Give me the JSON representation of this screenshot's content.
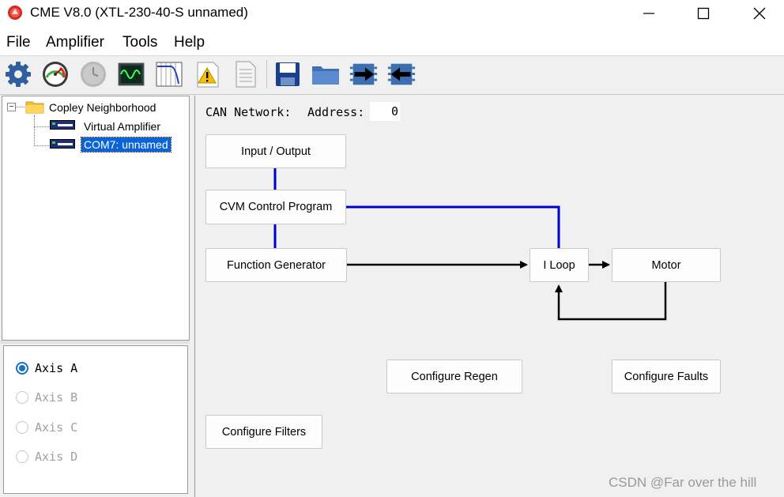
{
  "window": {
    "title": "CME V8.0 (XTL-230-40-S unnamed)",
    "controls": [
      "minimize",
      "maximize",
      "close"
    ]
  },
  "menubar": {
    "items": [
      "File",
      "Amplifier",
      "Tools",
      "Help"
    ]
  },
  "toolbar": {
    "buttons": [
      {
        "icon": "gear-icon",
        "enabled": true
      },
      {
        "icon": "gauge-icon",
        "enabled": true
      },
      {
        "icon": "clock-icon",
        "enabled": false
      },
      {
        "icon": "oscilloscope-icon",
        "enabled": true
      },
      {
        "icon": "filter-chart-icon",
        "enabled": true
      },
      {
        "icon": "warning-icon",
        "enabled": true
      },
      {
        "icon": "document-icon",
        "enabled": true
      },
      {
        "icon": "save-icon",
        "enabled": true
      },
      {
        "icon": "folder-icon",
        "enabled": true
      },
      {
        "icon": "download-to-amp-icon",
        "enabled": true
      },
      {
        "icon": "upload-from-amp-icon",
        "enabled": true
      }
    ]
  },
  "tree": {
    "root": "Copley Neighborhood",
    "children": [
      "Virtual Amplifier",
      "COM7: unnamed"
    ],
    "selected": "COM7: unnamed",
    "collapse_glyph": "−"
  },
  "axes": {
    "items": [
      {
        "label": "Axis A",
        "checked": true,
        "enabled": true
      },
      {
        "label": "Axis B",
        "checked": false,
        "enabled": false
      },
      {
        "label": "Axis C",
        "checked": false,
        "enabled": false
      },
      {
        "label": "Axis D",
        "checked": false,
        "enabled": false
      }
    ]
  },
  "main": {
    "can_network_label": "CAN Network:",
    "address_label": "Address:",
    "address_value": "0",
    "blocks": {
      "input_output": "Input / Output",
      "cvm_control_program": "CVM Control Program",
      "function_generator": "Function Generator",
      "i_loop": "I Loop",
      "motor": "Motor",
      "configure_regen": "Configure Regen",
      "configure_faults": "Configure Faults",
      "configure_filters": "Configure Filters"
    },
    "colors": {
      "blue_link": "#0000cc",
      "black_link": "#000000",
      "selection": "#0a64d6"
    }
  },
  "watermark": "CSDN @Far over the hill"
}
